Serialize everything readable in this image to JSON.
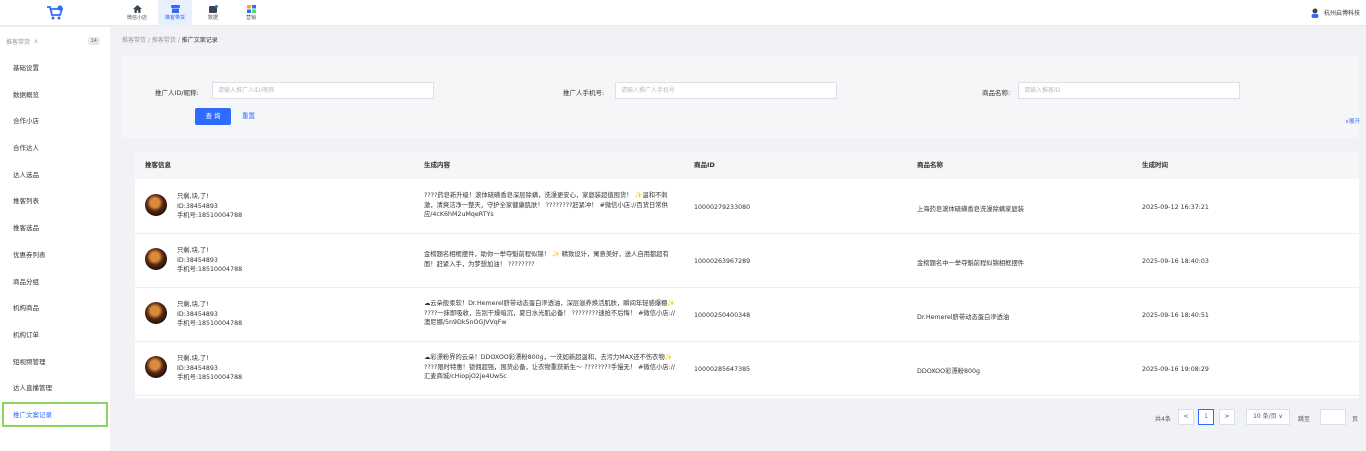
{
  "nav": [
    {
      "label": "微信小店",
      "icon": "home-icon"
    },
    {
      "label": "推客带货",
      "icon": "store-icon"
    },
    {
      "label": "数据",
      "icon": "data-icon"
    },
    {
      "label": "营销",
      "icon": "apps-icon"
    }
  ],
  "user": {
    "name": "杭州启博科技"
  },
  "sidebar": {
    "group_label": "推客带货",
    "group_count": "14",
    "items": [
      {
        "label": "基础设置"
      },
      {
        "label": "数据概览"
      },
      {
        "label": "合作小店"
      },
      {
        "label": "合作达人"
      },
      {
        "label": "达人选品"
      },
      {
        "label": "推客列表"
      },
      {
        "label": "推客选品"
      },
      {
        "label": "优惠券列表"
      },
      {
        "label": "商品分组"
      },
      {
        "label": "机构商品"
      },
      {
        "label": "机构订单"
      },
      {
        "label": "短视频管理"
      },
      {
        "label": "达人直播管理"
      },
      {
        "label": "推广文案记录"
      }
    ]
  },
  "breadcrumb": {
    "a": "推客带货",
    "sep": "/",
    "b": "推客带货",
    "cur": "推广文案记录"
  },
  "filter": {
    "promoter_label": "推广人ID/昵称:",
    "promoter_ph": "请输入推广人ID/昵称",
    "phone_label": "推广人手机号:",
    "phone_ph": "请输入推广人手机号",
    "product_label": "商品名称:",
    "product_ph": "请输入推客ID",
    "query": "查 询",
    "reset": "重置",
    "expand": "∨展开"
  },
  "table": {
    "headers": [
      "推客信息",
      "生成内容",
      "商品ID",
      "商品名称",
      "生成时间"
    ],
    "rows": [
      {
        "name": "只剩,块,了!",
        "id": "ID:38454893",
        "phone": "手机号:18510004788",
        "content": "????药皂新升级！滚体硫磺香皂深层除螨，洗澡更安心，家庭装超值囤货！ ✨温和不刺激，清爽洁净一整天，守护全家健康肌肤！ ????????赶紧冲！ #微信小店://百货日常供应/4cK6hM2uMqeRTYs",
        "product_id": "10000279233080",
        "product_name": "上海药皂滚体硫磺香皂洗澡除螨家庭装",
        "time": "2025-09-12 16:37:21"
      },
      {
        "name": "只剩,块,了!",
        "id": "ID:38454893",
        "phone": "手机号:18510004788",
        "content": "金榜题名相框摆件，助你一举夺魁前程似锦！ ✨ 精致设计，寓意美好，送人自用都超有面！赶紧入手，为梦想加油！ ????????",
        "product_id": "10000263967289",
        "product_name": "金榜题名中一举夺魁前程似锦相框摆件",
        "time": "2025-09-16 18:40:03"
      },
      {
        "name": "只剩,块,了!",
        "id": "ID:38454893",
        "phone": "手机号:18510004788",
        "content": "☁云朵般柔软！Dr.Hemerel脐带动态蛋白滲透油，深层滋养焕活肌肤，瞬间年轻感爆棚✨ ????一抹即吸收，告别干燥暗沉，夏日水光肌必备！ ????????速抢不后悔！ #微信小店://澳尼娜/5n9DkSnOGJVVqFw",
        "product_id": "10000250400348",
        "product_name": "Dr.Hemerel脐带动态蛋白滲透油",
        "time": "2025-09-16 18:40:51"
      },
      {
        "name": "只剩,块,了!",
        "id": "ID:38454893",
        "phone": "手机号:18510004788",
        "content": "☁彩漂粉界的云朵！DDOXOO彩漂粉800g，一洗如新超温和，去污力MAX还不伤衣物✨ ????限时特惠！锁佣超强，囤货必备，让衣物重获新生～ ????????手慢无！ #微信小店://汇麦商城/cHiopjO2je4UwSc",
        "product_id": "10000285647385",
        "product_name": "DDOXOO彩漂粉800g",
        "time": "2025-09-16 19:08:29"
      }
    ]
  },
  "pagination": {
    "total": "共4条",
    "prev": "<",
    "page": "1",
    "next": ">",
    "size": "10 条/页 ∨",
    "goto": "跳至",
    "page_unit": "页"
  },
  "colors": {
    "accent": "#2f6bff",
    "highlight": "#8dd35f"
  }
}
